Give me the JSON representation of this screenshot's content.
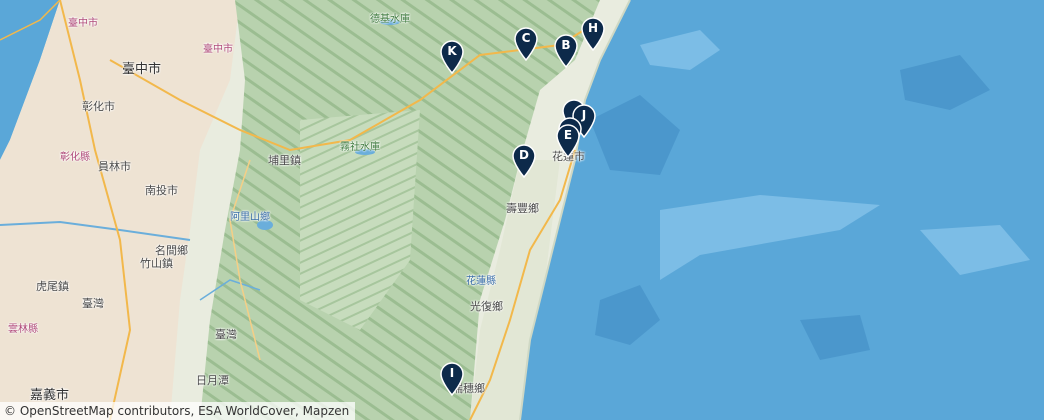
{
  "map": {
    "colors": {
      "sea": "#5aa7d8",
      "land": "#dfe8d6",
      "mountain": "#a9c8a0",
      "urban": "#e8d8c8",
      "road": "#f2b84b",
      "marker": "#0d2a4a"
    },
    "places": [
      {
        "id": "taichung",
        "text": "臺中市",
        "kind": "big"
      },
      {
        "id": "taichung-label2",
        "text": "臺中市",
        "kind": "pink"
      },
      {
        "id": "changhua",
        "text": "彰化市",
        "kind": "normal"
      },
      {
        "id": "changhua-county",
        "text": "彰化縣",
        "kind": "pink"
      },
      {
        "id": "yuanlin",
        "text": "員林市",
        "kind": "normal"
      },
      {
        "id": "nantou",
        "text": "南投市",
        "kind": "normal"
      },
      {
        "id": "mingjian",
        "text": "名間鄉",
        "kind": "normal"
      },
      {
        "id": "zhushan",
        "text": "竹山鎮",
        "kind": "normal"
      },
      {
        "id": "huwei",
        "text": "虎尾鎮",
        "kind": "normal"
      },
      {
        "id": "taiwan1",
        "text": "臺灣",
        "kind": "normal"
      },
      {
        "id": "taiwan2",
        "text": "臺灣",
        "kind": "normal"
      },
      {
        "id": "yunlin",
        "text": "雲林縣",
        "kind": "pink"
      },
      {
        "id": "chiayi",
        "text": "嘉義市",
        "kind": "big"
      },
      {
        "id": "puli",
        "text": "埔里鎮",
        "kind": "normal"
      },
      {
        "id": "sunmoon",
        "text": "日月潭",
        "kind": "blue"
      },
      {
        "id": "alishan",
        "text": "阿里山鄉",
        "kind": "normal"
      },
      {
        "id": "wushe",
        "text": "霧社水庫",
        "kind": "blue"
      },
      {
        "id": "deji",
        "text": "德基水庫",
        "kind": "blue"
      },
      {
        "id": "hualien-city",
        "text": "花蓮市",
        "kind": "normal"
      },
      {
        "id": "shoufeng",
        "text": "壽豐鄉",
        "kind": "normal"
      },
      {
        "id": "hualien-county",
        "text": "花蓮縣",
        "kind": "blue"
      },
      {
        "id": "guangfu",
        "text": "光復鄉",
        "kind": "normal"
      },
      {
        "id": "ruisui",
        "text": "瑞穗鄉",
        "kind": "normal"
      }
    ],
    "markers": [
      {
        "label": "K"
      },
      {
        "label": "C"
      },
      {
        "label": "B"
      },
      {
        "label": "H"
      },
      {
        "label": "J"
      },
      {
        "label": "E"
      },
      {
        "label": "D"
      },
      {
        "label": "I"
      }
    ],
    "attribution": "© OpenStreetMap contributors, ESA WorldCover, Mapzen"
  }
}
